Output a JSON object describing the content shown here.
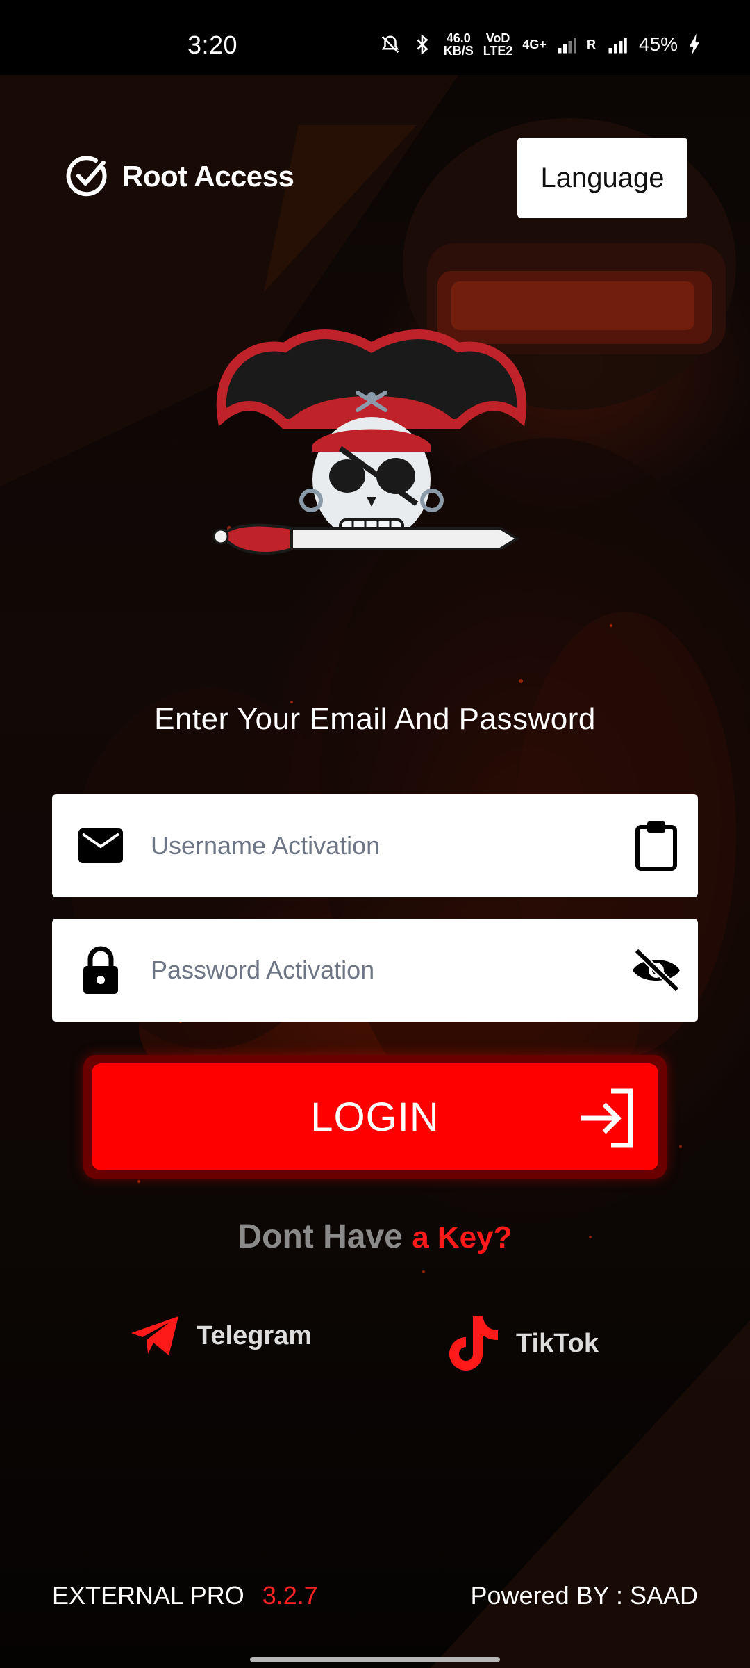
{
  "status_bar": {
    "time": "3:20",
    "net_speed": "46.0",
    "net_speed_unit": "KB/S",
    "volte_top": "VoD",
    "volte_bottom": "LTE2",
    "net_type": "4G+",
    "roaming": "R",
    "battery": "45%"
  },
  "header": {
    "root_access_label": "Root Access",
    "language_button": "Language"
  },
  "form": {
    "prompt": "Enter Your Email And Password",
    "username_placeholder": "Username Activation",
    "password_placeholder": "Password Activation",
    "login_label": "LOGIN"
  },
  "no_key": {
    "part1": "Dont Have ",
    "part2": "a Key?"
  },
  "social": {
    "telegram": "Telegram",
    "tiktok": "TikTok"
  },
  "footer": {
    "app_name": "EXTERNAL PRO",
    "version": "3.2.7",
    "powered_by": "Powered BY : SAAD"
  },
  "colors": {
    "accent": "#ff0000",
    "background": "#0d0705",
    "text_muted": "#8a8a8a"
  }
}
